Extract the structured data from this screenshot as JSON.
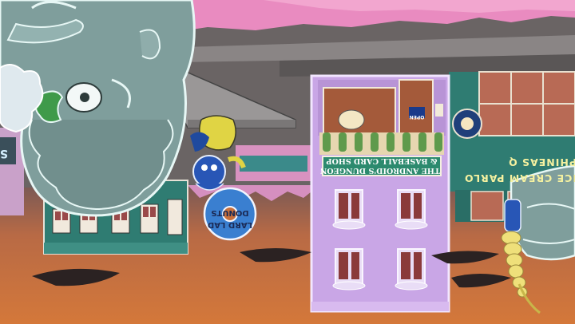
{
  "scene": {
    "dungeon_sign": {
      "line1": "THE ANDROID'S DUNGEON",
      "line2": "& BASEBALL CARD SHOP"
    },
    "parlor_sign": {
      "line1": "ICE CREAM PARLO",
      "line2": "PHINEAS Q"
    },
    "donut_sign": {
      "line1": "LARD LAD",
      "line2": "DONUTS"
    },
    "open_sign": "OPEN",
    "side_letter": "S"
  },
  "colors": {
    "sky": "#e98bc0",
    "ground": "#c8703c",
    "shop_wall": "#c9a6e6",
    "teal_building": "#2f7c72",
    "statue": "#7f9e9c"
  }
}
